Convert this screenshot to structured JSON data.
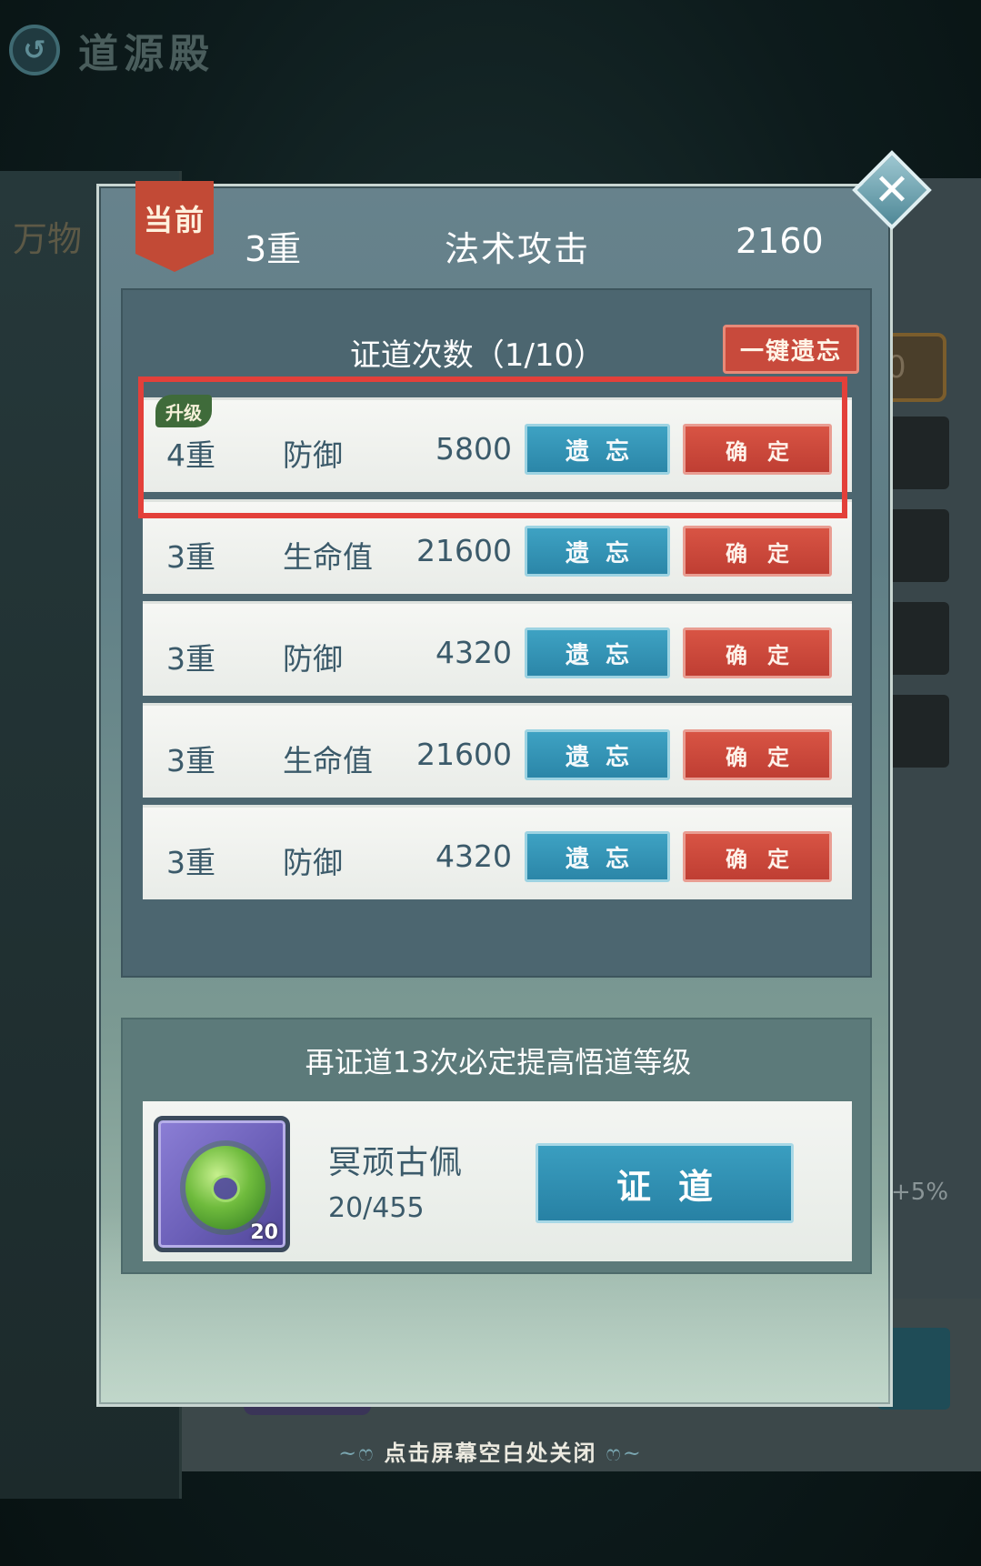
{
  "header": {
    "back_icon": "back-arrow-icon",
    "title": "道源殿"
  },
  "background": {
    "left_tab": "万物",
    "right_value": "0",
    "right_pct": "+5%"
  },
  "modal": {
    "current_tag": "当前",
    "current_level": "3重",
    "current_stat": "法术攻击",
    "current_value": "2160",
    "close_icon": "close-x-icon",
    "count_label": "证道次数（1/10）",
    "forget_all_label": "一键遗忘",
    "forget_label": "遗忘",
    "confirm_label": "确定",
    "upgrade_badge": "升级",
    "options": [
      {
        "level": "4重",
        "stat": "防御",
        "value": "5800",
        "upgrade": true,
        "highlighted": true
      },
      {
        "level": "3重",
        "stat": "生命值",
        "value": "21600",
        "upgrade": false,
        "highlighted": false
      },
      {
        "level": "3重",
        "stat": "防御",
        "value": "4320",
        "upgrade": false,
        "highlighted": false
      },
      {
        "level": "3重",
        "stat": "生命值",
        "value": "21600",
        "upgrade": false,
        "highlighted": false
      },
      {
        "level": "3重",
        "stat": "防御",
        "value": "4320",
        "upgrade": false,
        "highlighted": false
      }
    ],
    "hint_text": "再证道13次必定提高悟道等级",
    "item": {
      "name": "冥顽古佩",
      "progress": "20/455",
      "count": "20",
      "icon": "jade-pendant-icon"
    },
    "verify_label": "证道"
  },
  "footer": {
    "close_hint": "点击屏幕空白处关闭"
  },
  "colors": {
    "accent_red": "#c84a3c",
    "accent_blue": "#2b86a8",
    "highlight": "#e3403a"
  }
}
